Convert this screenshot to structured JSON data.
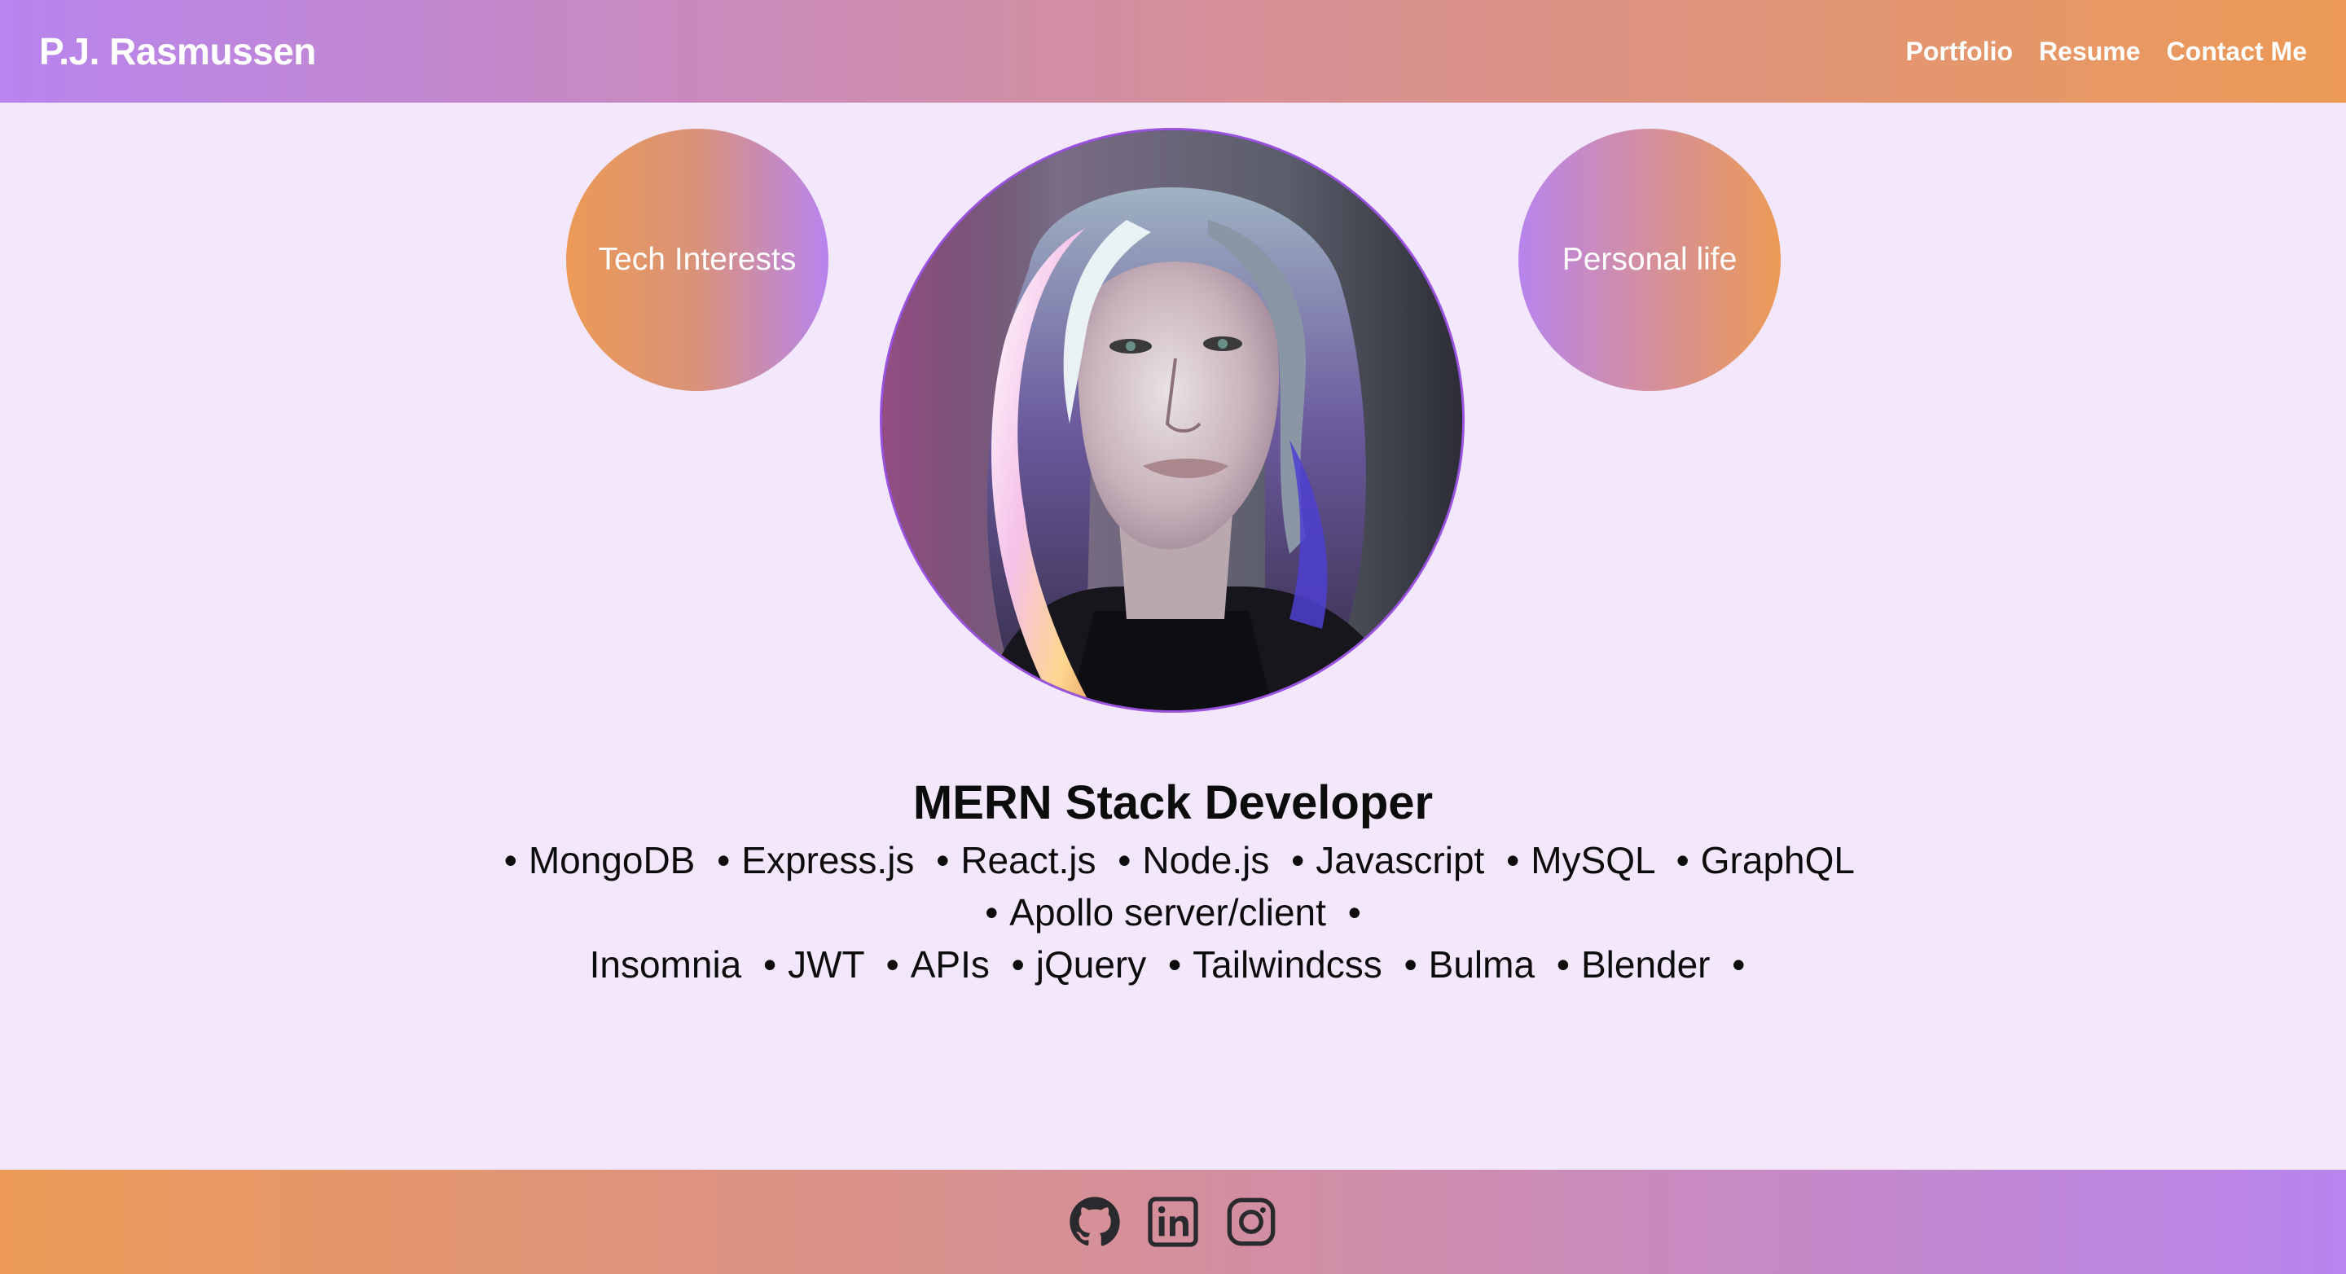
{
  "header": {
    "brand": "P.J. Rasmussen",
    "nav": [
      {
        "label": "Portfolio"
      },
      {
        "label": "Resume"
      },
      {
        "label": "Contact Me"
      }
    ]
  },
  "bubbles": {
    "left": "Tech Interests",
    "right": "Personal life"
  },
  "profile": {
    "avatar_icon": "portrait-photo",
    "headline": "MERN Stack Developer",
    "skills": [
      "MongoDB",
      "Express.js",
      "React.js",
      "Node.js",
      "Javascript",
      "MySQL",
      "GraphQL",
      "Apollo server/client",
      "Insomnia",
      "JWT",
      "APIs",
      "jQuery",
      "Tailwindcss",
      "Bulma",
      "Blender"
    ],
    "separator": "•"
  },
  "footer": {
    "icons": [
      "github-icon",
      "linkedin-icon",
      "instagram-icon"
    ]
  },
  "colors": {
    "purple": "#b884ee",
    "orange": "#ec9a56",
    "page_bg": "#f2e7fb",
    "avatar_border": "#9b52e0"
  }
}
